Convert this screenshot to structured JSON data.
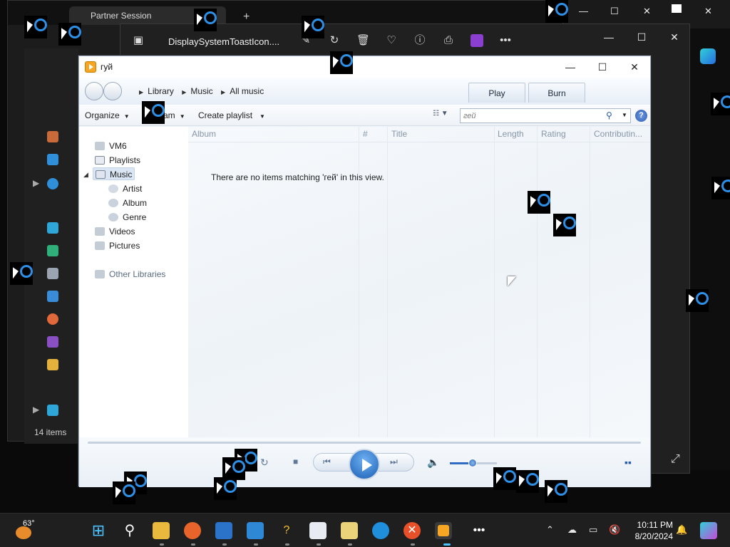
{
  "background_window": {
    "tab_title": "Partner Session",
    "status": "14 items"
  },
  "photos_window": {
    "title": "DisplaySystemToastIcon...."
  },
  "wmp": {
    "title": "гуй",
    "breadcrumb": [
      "Library",
      "Music",
      "All music"
    ],
    "tabs": {
      "play": "Play",
      "burn": "Burn"
    },
    "toolbar": {
      "organize": "Organize",
      "stream": "Stream",
      "create_playlist": "Create playlist"
    },
    "search": {
      "value": "гей"
    },
    "help_glyph": "?",
    "nav": {
      "vm": "VM6",
      "playlists": "Playlists",
      "music": "Music",
      "artist": "Artist",
      "album": "Album",
      "genre": "Genre",
      "videos": "Videos",
      "pictures": "Pictures",
      "other_libraries": "Other Libraries"
    },
    "columns": [
      "Album",
      "#",
      "Title",
      "Length",
      "Rating",
      "Contributin..."
    ],
    "empty_message": "There are no items matching 'гей' in this view.",
    "volume_level": 0.5
  },
  "taskbar": {
    "temperature": "63°",
    "time": "10:11 PM",
    "date": "8/20/2024"
  },
  "colors": {
    "accent": "#1b5fb4",
    "taskbar": "#1f1f1f",
    "wmp_bg": "#f0f4f9"
  }
}
